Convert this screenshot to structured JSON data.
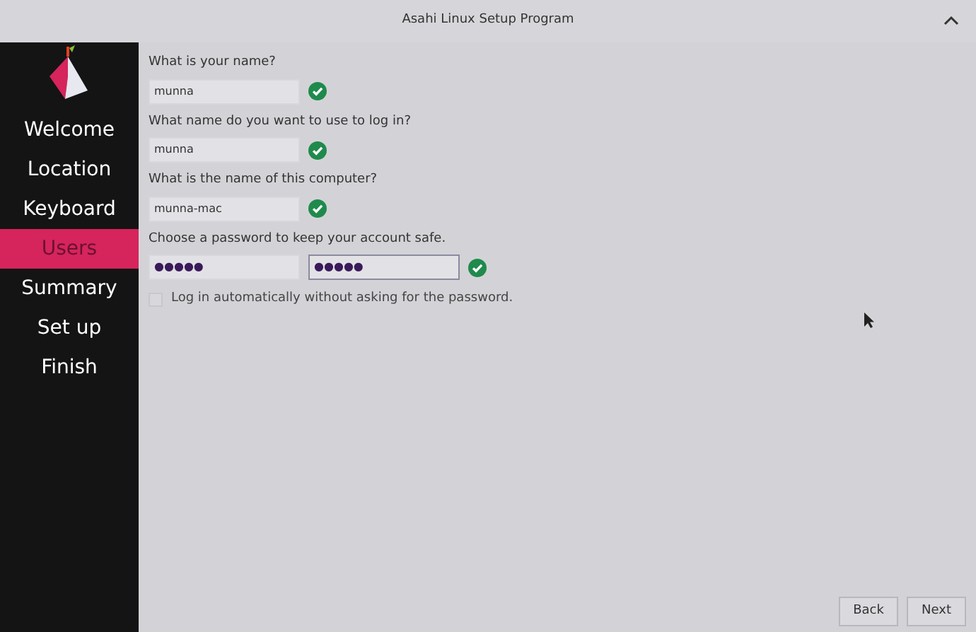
{
  "window": {
    "title": "Asahi Linux Setup Program"
  },
  "sidebar": {
    "items": [
      {
        "label": "Welcome",
        "selected": false
      },
      {
        "label": "Location",
        "selected": false
      },
      {
        "label": "Keyboard",
        "selected": false
      },
      {
        "label": "Users",
        "selected": true
      },
      {
        "label": "Summary",
        "selected": false
      },
      {
        "label": "Set up",
        "selected": false
      },
      {
        "label": "Finish",
        "selected": false
      }
    ]
  },
  "form": {
    "questions": [
      {
        "label": "What is your name?",
        "fields": [
          {
            "value": "munna",
            "focused": false
          }
        ],
        "valid": true
      },
      {
        "label": "What name do you want to use to log in?",
        "fields": [
          {
            "value": "munna",
            "focused": false
          }
        ],
        "valid": true
      },
      {
        "label": "What is the name of this computer?",
        "fields": [
          {
            "value": "munna-mac",
            "focused": false
          }
        ],
        "valid": true
      },
      {
        "label": "Choose a password to keep your account safe.",
        "fields": [
          {
            "value": "●●●●●",
            "focused": false
          },
          {
            "value": "●●●●●",
            "focused": true
          }
        ],
        "valid": true
      }
    ],
    "autologin": {
      "label": "Log in automatically without asking for the password.",
      "checked": false
    }
  },
  "buttons": [
    "Back",
    "Next"
  ]
}
